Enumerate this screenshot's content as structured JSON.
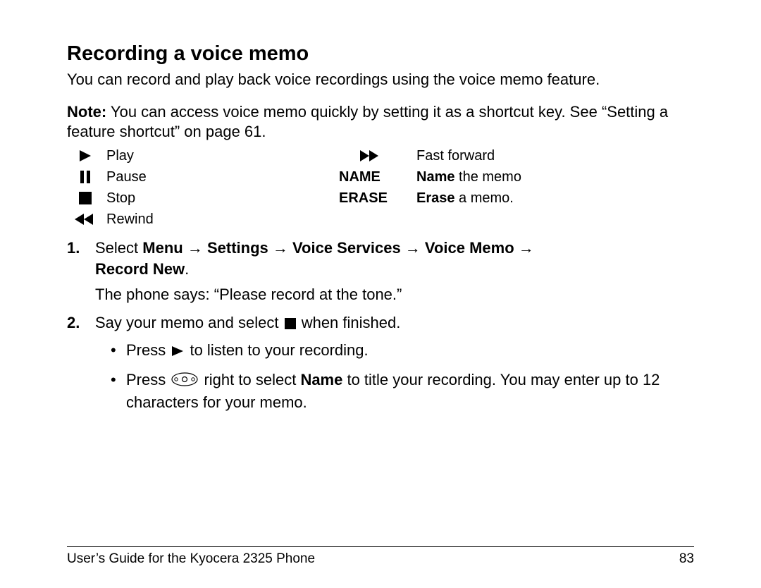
{
  "heading": "Recording a voice memo",
  "intro": "You can record and play back voice recordings using the voice memo feature.",
  "note_label": "Note:",
  "note_text": " You can access voice memo quickly by setting it as a shortcut key. See “Setting a feature shortcut” on page 61.",
  "icons": {
    "play": "Play",
    "pause": "Pause",
    "stop": "Stop",
    "rewind": "Rewind",
    "ff": "Fast forward",
    "name_key": "NAME",
    "name_desc_bold": "Name",
    "name_desc_rest": " the memo",
    "erase_key": "ERASE",
    "erase_desc_bold": "Erase",
    "erase_desc_rest": " a memo."
  },
  "steps": {
    "s1_num": "1.",
    "s1_prefix": "Select ",
    "s1_menu": "Menu",
    "s1_arrow": " → ",
    "s1_settings": "Settings",
    "s1_vs": "Voice Services",
    "s1_vm": "Voice Memo",
    "s1_rn": "Record New",
    "s1_period": ".",
    "s1_sub": "The phone says: “Please record at the tone.”",
    "s2_num": "2.",
    "s2_a": "Say your memo and select ",
    "s2_b": " when finished.",
    "s2_bullet1_a": "Press ",
    "s2_bullet1_b": " to listen to your recording.",
    "s2_bullet2_a": "Press ",
    "s2_bullet2_b": " right to select ",
    "s2_bullet2_name": "Name",
    "s2_bullet2_c": " to title your recording. You may enter up to 12 characters for your memo."
  },
  "footer": {
    "left": "User’s Guide for the Kyocera 2325 Phone",
    "right": "83"
  }
}
